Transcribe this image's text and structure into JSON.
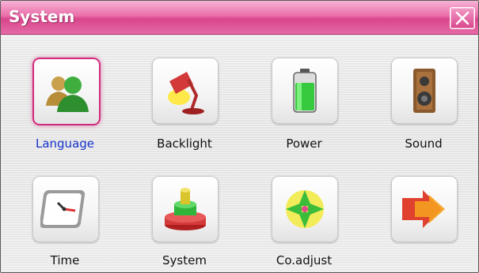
{
  "window": {
    "title": "System"
  },
  "items": [
    {
      "label": "Language",
      "icon": "language-icon",
      "selected": true
    },
    {
      "label": "Backlight",
      "icon": "backlight-lamp-icon",
      "selected": false
    },
    {
      "label": "Power",
      "icon": "battery-icon",
      "selected": false
    },
    {
      "label": "Sound",
      "icon": "speaker-icon",
      "selected": false
    },
    {
      "label": "Time",
      "icon": "clock-icon",
      "selected": false
    },
    {
      "label": "System",
      "icon": "system-stack-icon",
      "selected": false
    },
    {
      "label": "Co.adjust",
      "icon": "crosshair-target-icon",
      "selected": false
    },
    {
      "label": "",
      "icon": "next-page-arrow-icon",
      "selected": false
    }
  ],
  "colors": {
    "title_bar": "#e56aa6",
    "selected_label": "#1431c8",
    "selected_border": "#d22c7e"
  }
}
